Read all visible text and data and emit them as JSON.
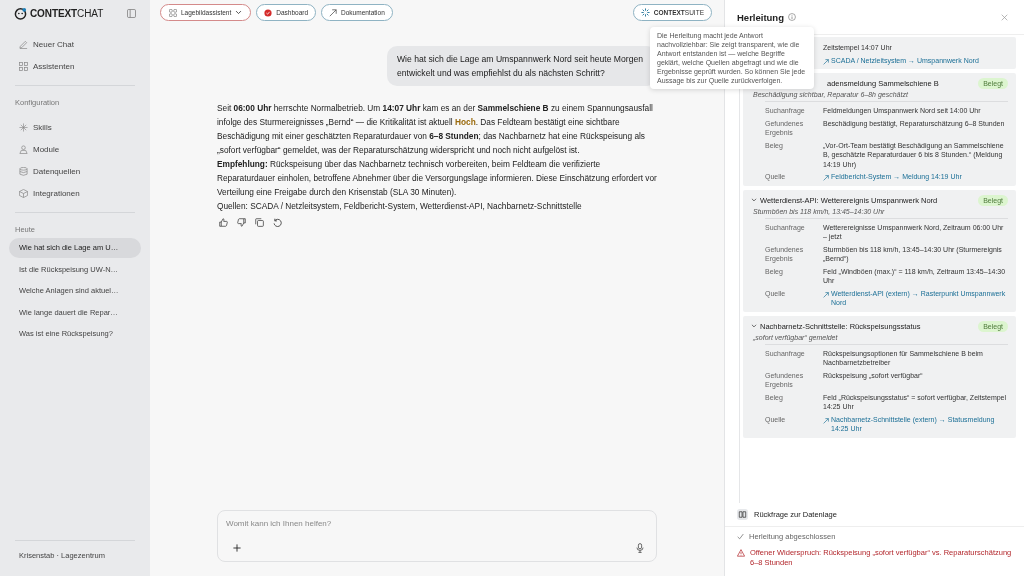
{
  "sidebar": {
    "brand": "**CONTEXT**CHAT",
    "nav": [
      {
        "label": "Neuer Chat"
      },
      {
        "label": "Assistenten"
      }
    ],
    "config_heading": "Konfiguration",
    "config": [
      {
        "label": "Skills"
      },
      {
        "label": "Module"
      },
      {
        "label": "Datenquellen"
      },
      {
        "label": "Integrationen"
      }
    ],
    "history_heading": "Heute",
    "history": [
      {
        "label": "Wie hat sich die Lage am U…",
        "selected": true
      },
      {
        "label": "Ist die Rückspeisung UW-N…",
        "selected": false
      },
      {
        "label": "Welche Anlagen sind aktuel…",
        "selected": false
      },
      {
        "label": "Wie lange dauert die Repar…",
        "selected": false
      },
      {
        "label": "Was ist eine Rückspeisung?",
        "selected": false
      }
    ],
    "footer": "Krisenstab · Lagezentrum"
  },
  "toolbar": {
    "buttons": [
      {
        "label": "Lagebildassistent",
        "kind": "dropdown"
      },
      {
        "label": "Dashboard",
        "kind": "status"
      },
      {
        "label": "Dokumentation",
        "kind": "link"
      }
    ],
    "suite": "**CONTEXT**SUITE"
  },
  "chat": {
    "question": "Wie hat sich die Lage am Umspannwerk Nord seit heute Morgen entwickelt und was empfiehlst du als nächsten Schritt?",
    "answer_segments": [
      {
        "text": "Seit ",
        "kind": "plain"
      },
      {
        "text": "06:00 Uhr",
        "kind": "bold"
      },
      {
        "text": " herrschte Normalbetrieb. Um ",
        "kind": "plain"
      },
      {
        "text": "14:07 Uhr",
        "kind": "bold"
      },
      {
        "text": " kam es an der ",
        "kind": "plain"
      },
      {
        "text": "Sammelschiene B",
        "kind": "bold"
      },
      {
        "text": " zu einem Spannungsausfall infolge des Sturmereignisses „Bernd“ — die Kritikalität ist aktuell ",
        "kind": "plain"
      },
      {
        "text": "Hoch",
        "kind": "alert"
      },
      {
        "text": ". Das Feldteam bestätigt eine sichtbare Beschädigung mit einer geschätzten Reparaturdauer von ",
        "kind": "plain"
      },
      {
        "text": "6–8 Stunden",
        "kind": "bold"
      },
      {
        "text": "; das Nachbarnetz hat eine Rückspeisung als „sofort verfügbar“ gemeldet, was der Reparaturschätzung widerspricht und noch nicht aufgelöst ist.",
        "kind": "plain"
      }
    ],
    "recommendation": "**Empfehlung:** Rückspeisung über das Nachbarnetz technisch vorbereiten, beim Feldteam die verifizierte Reparaturdauer einholen, betroffene Abnehmer über die Versorgungslage informieren. Diese Einschätzung erfordert vor Verteilung eine Freigabe durch den Krisenstab (SLA 30 Minuten).",
    "sources": "Quellen: SCADA / Netzleitsystem, Feldbericht-System, Wetterdienst-API, Nachbarnetz-Schnittstelle",
    "composer": {
      "placeholder": "Womit kann ich Ihnen helfen?"
    }
  },
  "panel": {
    "title": "Herleitung",
    "tooltip": "Die Herleitung macht jede Antwort nachvollziehbar: Sie zeigt transparent, wie die Antwort entstanden ist — welche Begriffe geklärt, welche Quellen abgefragt und wie die Ergebnisse geprüft wurden. So können Sie jede Aussage bis zur Quelle zurückverfolgen.",
    "steps": [
      {
        "rows": [
          {
            "value": "Zeitstempel 14:07 Uhr",
            "kind": "text"
          },
          {
            "value": "SCADA / Netzleitsystem → Umspannwerk Nord",
            "kind": "link"
          }
        ]
      },
      {
        "title": "adensmeldung Sammelschiene B",
        "status": "Belegt",
        "subtitle": "Beschädigung sichtbar, Reparatur 6–8h geschätzt",
        "rows": [
          {
            "label": "Suchanfrage",
            "value": "Feldmeldungen Umspannwerk Nord seit 14:00 Uhr",
            "kind": "text"
          },
          {
            "label": "Gefundenes Ergebnis",
            "value": "Beschädigung bestätigt, Reparaturschätzung 6–8 Stunden",
            "kind": "text"
          },
          {
            "label": "Beleg",
            "value": "„Vor-Ort-Team bestätigt Beschädigung an Sammelschiene B, geschätzte Reparaturdauer 6 bis 8 Stunden.“ (Meldung 14:19 Uhr)",
            "kind": "text"
          },
          {
            "label": "Quelle",
            "value": "Feldbericht-System → Meldung 14:19 Uhr",
            "kind": "link"
          }
        ]
      },
      {
        "title": "Wetterdienst-API: Wetterereignis Umspannwerk Nord",
        "status": "Belegt",
        "expanded": true,
        "subtitle": "Sturmböen bis 118 km/h, 13:45–14:30 Uhr",
        "rows": [
          {
            "label": "Suchanfrage",
            "value": "Wetterereignisse Umspannwerk Nord, Zeitraum 06:00 Uhr – jetzt",
            "kind": "text"
          },
          {
            "label": "Gefundenes Ergebnis",
            "value": "Sturmböen bis 118 km/h, 13:45–14:30 Uhr (Sturmereignis „Bernd“)",
            "kind": "text"
          },
          {
            "label": "Beleg",
            "value": "Feld „Windböen (max.)“ = 118 km/h, Zeitraum 13:45–14:30 Uhr",
            "kind": "text"
          },
          {
            "label": "Quelle",
            "value": "Wetterdienst-API (extern) → Rasterpunkt Umspannwerk Nord",
            "kind": "link"
          }
        ]
      },
      {
        "title": "Nachbarnetz-Schnittstelle: Rückspeisungsstatus",
        "status": "Belegt",
        "expanded": true,
        "subtitle": "„sofort verfügbar“ gemeldet",
        "rows": [
          {
            "label": "Suchanfrage",
            "value": "Rückspeisungsoptionen für Sammelschiene B beim Nachbarnetzbetreiber",
            "kind": "text"
          },
          {
            "label": "Gefundenes Ergebnis",
            "value": "Rückspeisung „sofort verfügbar“",
            "kind": "text"
          },
          {
            "label": "Beleg",
            "value": "Feld „Rückspeisungsstatus“ = sofort verfügbar, Zeitstempel 14:25 Uhr",
            "kind": "text"
          },
          {
            "label": "Quelle",
            "value": "Nachbarnetz-Schnittstelle (extern) → Statusmeldung 14:25 Uhr",
            "kind": "link"
          }
        ]
      }
    ],
    "followup": "Rückfrage zur Datenlage",
    "status": [
      {
        "kind": "done",
        "text": "Herleitung abgeschlossen"
      },
      {
        "kind": "warning",
        "text": "Offener Widerspruch: Rückspeisung „sofort verfügbar“ vs. Reparaturschätzung 6–8 Stunden"
      }
    ]
  }
}
